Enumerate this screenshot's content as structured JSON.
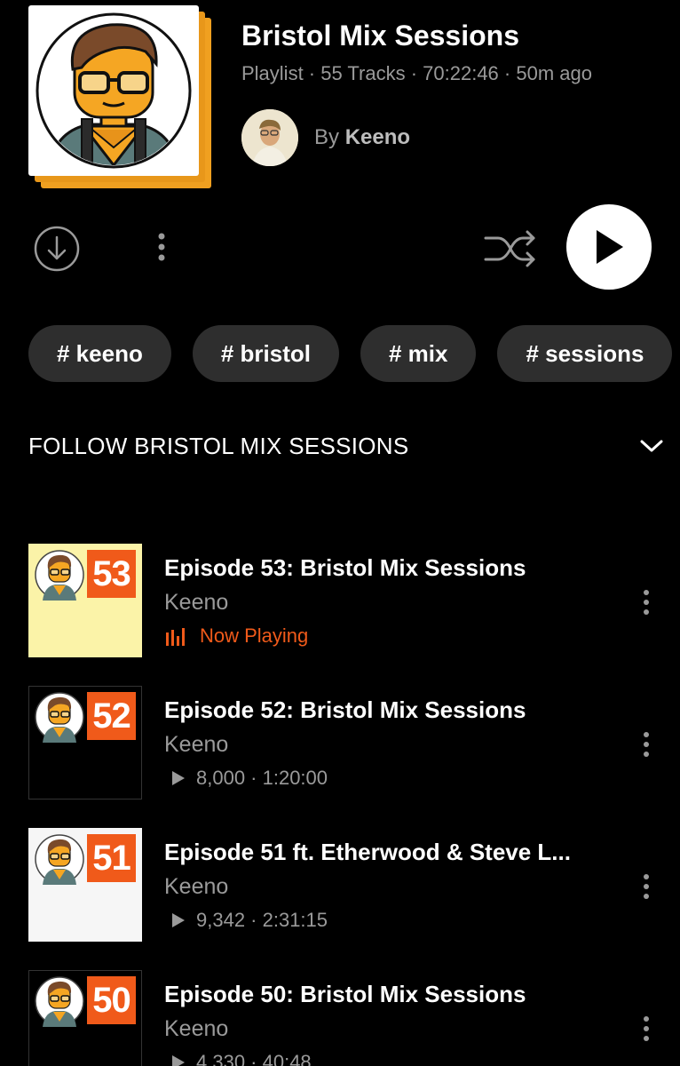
{
  "colors": {
    "background": "#000000",
    "accent": "#f05a1a",
    "secondary_text": "#9a9a9a",
    "chip": "#2e2e2e",
    "art_orange": "#f0a020"
  },
  "playlist": {
    "title": "Bristol Mix Sessions",
    "meta": "Playlist · 55 Tracks · 70:22:46 · 50m ago",
    "by_label": "By",
    "owner": "Keeno"
  },
  "controls": {
    "download_icon": "download-circle-icon",
    "more_icon": "more-vertical-icon",
    "shuffle_icon": "shuffle-icon",
    "play_icon": "play-icon"
  },
  "tags": [
    "# keeno",
    "# bristol",
    "# mix",
    "# sessions"
  ],
  "follow": {
    "label": "FOLLOW BRISTOL MIX SESSIONS",
    "icon": "chevron-down-icon"
  },
  "tracks": [
    {
      "number": "53",
      "title": "Episode 53: Bristol Mix Sessions",
      "artist": "Keeno",
      "now_playing": true,
      "status": "Now Playing",
      "thumb_bg": "#fbf3a8"
    },
    {
      "number": "52",
      "title": "Episode 52: Bristol Mix Sessions",
      "artist": "Keeno",
      "now_playing": false,
      "plays": "8,000",
      "duration": "1:20:00",
      "stats": "8,000 · 1:20:00",
      "thumb_bg": "#000000"
    },
    {
      "number": "51",
      "title": "Episode 51 ft. Etherwood & Steve L...",
      "artist": "Keeno",
      "now_playing": false,
      "plays": "9,342",
      "duration": "2:31:15",
      "stats": "9,342 · 2:31:15",
      "thumb_bg": "#f6f6f6"
    },
    {
      "number": "50",
      "title": "Episode 50: Bristol Mix Sessions",
      "artist": "Keeno",
      "now_playing": false,
      "plays": "4,330",
      "duration": "40:48",
      "stats": "4,330 · 40:48",
      "thumb_bg": "#000000"
    }
  ]
}
